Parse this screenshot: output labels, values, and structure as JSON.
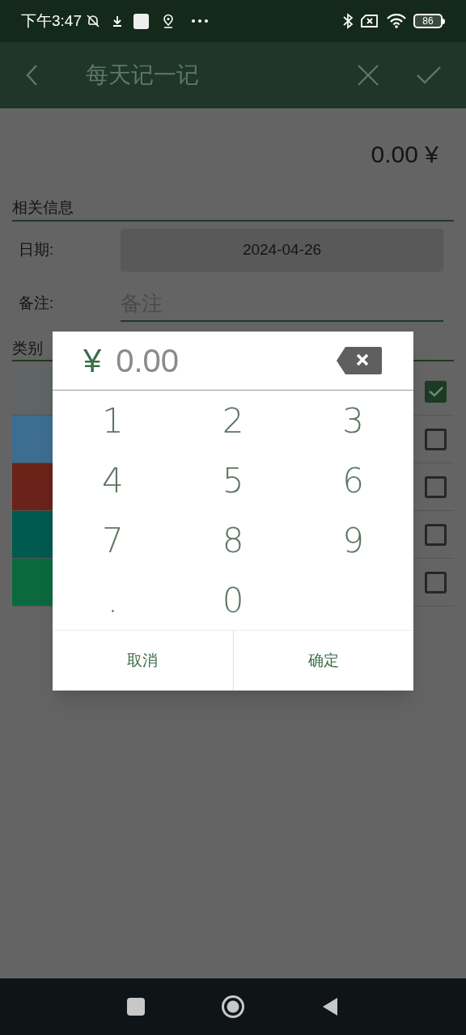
{
  "status_bar": {
    "time": "下午3:47",
    "battery": "86"
  },
  "app_bar": {
    "title": "每天记一记"
  },
  "amount": "0.00 ¥",
  "info_section": {
    "title": "相关信息",
    "date_label": "日期:",
    "date_value": "2024-04-26",
    "note_label": "备注:",
    "note_placeholder": "备注"
  },
  "category_section": {
    "title": "类别",
    "items": [
      {
        "color": "#5f6464",
        "checked": true
      },
      {
        "color": "#3d6d90",
        "checked": false
      },
      {
        "color": "#6b2219",
        "checked": false
      },
      {
        "color": "#005a4f",
        "checked": false
      },
      {
        "color": "#0b6a3d",
        "checked": false
      }
    ]
  },
  "keypad_dialog": {
    "currency": "¥",
    "value": "0.00",
    "key_rows": [
      [
        "1",
        "2",
        "3"
      ],
      [
        "4",
        "5",
        "6"
      ],
      [
        "7",
        "8",
        "9"
      ],
      [
        ".",
        "0"
      ]
    ],
    "buttons": [
      "取消",
      "确定"
    ]
  }
}
